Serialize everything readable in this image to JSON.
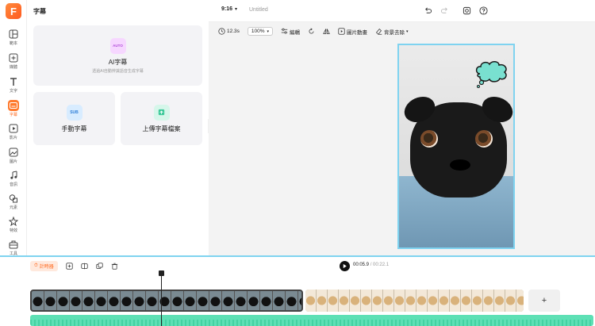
{
  "app": {
    "logo_letter": "F"
  },
  "rail": {
    "items": [
      {
        "label": "範本",
        "icon": "layout-icon"
      },
      {
        "label": "媒體",
        "icon": "media-plus-icon"
      },
      {
        "label": "文字",
        "icon": "text-icon"
      },
      {
        "label": "字幕",
        "icon": "subtitle-icon",
        "active": true
      },
      {
        "label": "影片",
        "icon": "video-icon"
      },
      {
        "label": "圖片",
        "icon": "image-icon"
      },
      {
        "label": "音訊",
        "icon": "music-icon"
      },
      {
        "label": "元素",
        "icon": "elements-icon"
      },
      {
        "label": "特效",
        "icon": "effects-icon"
      },
      {
        "label": "工具",
        "icon": "toolbox-icon"
      }
    ]
  },
  "panel": {
    "title": "字幕",
    "ai_card": {
      "badge": "AUTO",
      "title": "AI字幕",
      "subtitle": "透過AI自動辨識語音生成字幕"
    },
    "manual_card": {
      "badge": "SUB",
      "title": "手動字幕"
    },
    "upload_card": {
      "title": "上傳字幕檔案"
    }
  },
  "topbar": {
    "aspect": "9:16",
    "doc_title": "Untitled"
  },
  "toolbar": {
    "duration": "12.3s",
    "zoom": "100%",
    "edit_label": "編輯",
    "animation_label": "圖片動畫",
    "bg_remove_label": "背景去除"
  },
  "timeline": {
    "timer_label": "計時器",
    "current_time": "00:05.9",
    "separator": "/",
    "total_time": "00:22.1",
    "add_label": "+"
  },
  "colors": {
    "accent": "#ff6a1f",
    "selection": "#7fd3f0",
    "audio_track": "#5ee0b5"
  }
}
